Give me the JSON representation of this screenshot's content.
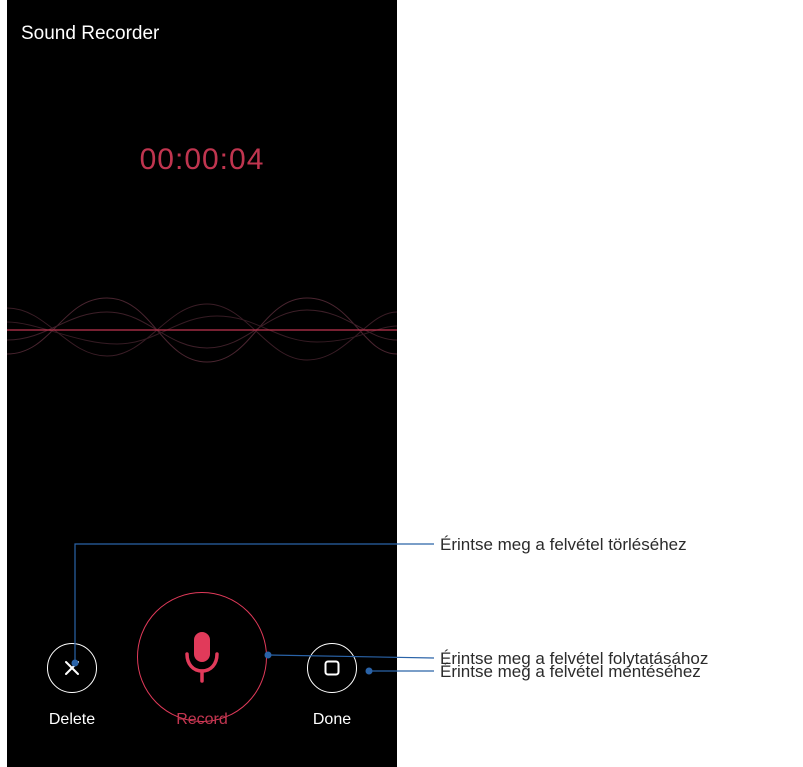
{
  "app": {
    "title": "Sound Recorder"
  },
  "recorder": {
    "elapsed_time": "00:00:04"
  },
  "controls": {
    "delete_label": "Delete",
    "record_label": "Record",
    "done_label": "Done"
  },
  "callouts": {
    "delete": "Érintse meg a felvétel törléséhez",
    "resume": "Érintse meg a felvétel folytatásához",
    "save": "Érintse meg a felvétel mentéséhez"
  },
  "colors": {
    "background": "#000000",
    "accent": "#e13a5a",
    "timer_text": "#c0354f",
    "leader_line": "#2a63a8"
  },
  "icons": {
    "delete": "close-icon",
    "record": "microphone-icon",
    "done": "stop-square-icon"
  }
}
